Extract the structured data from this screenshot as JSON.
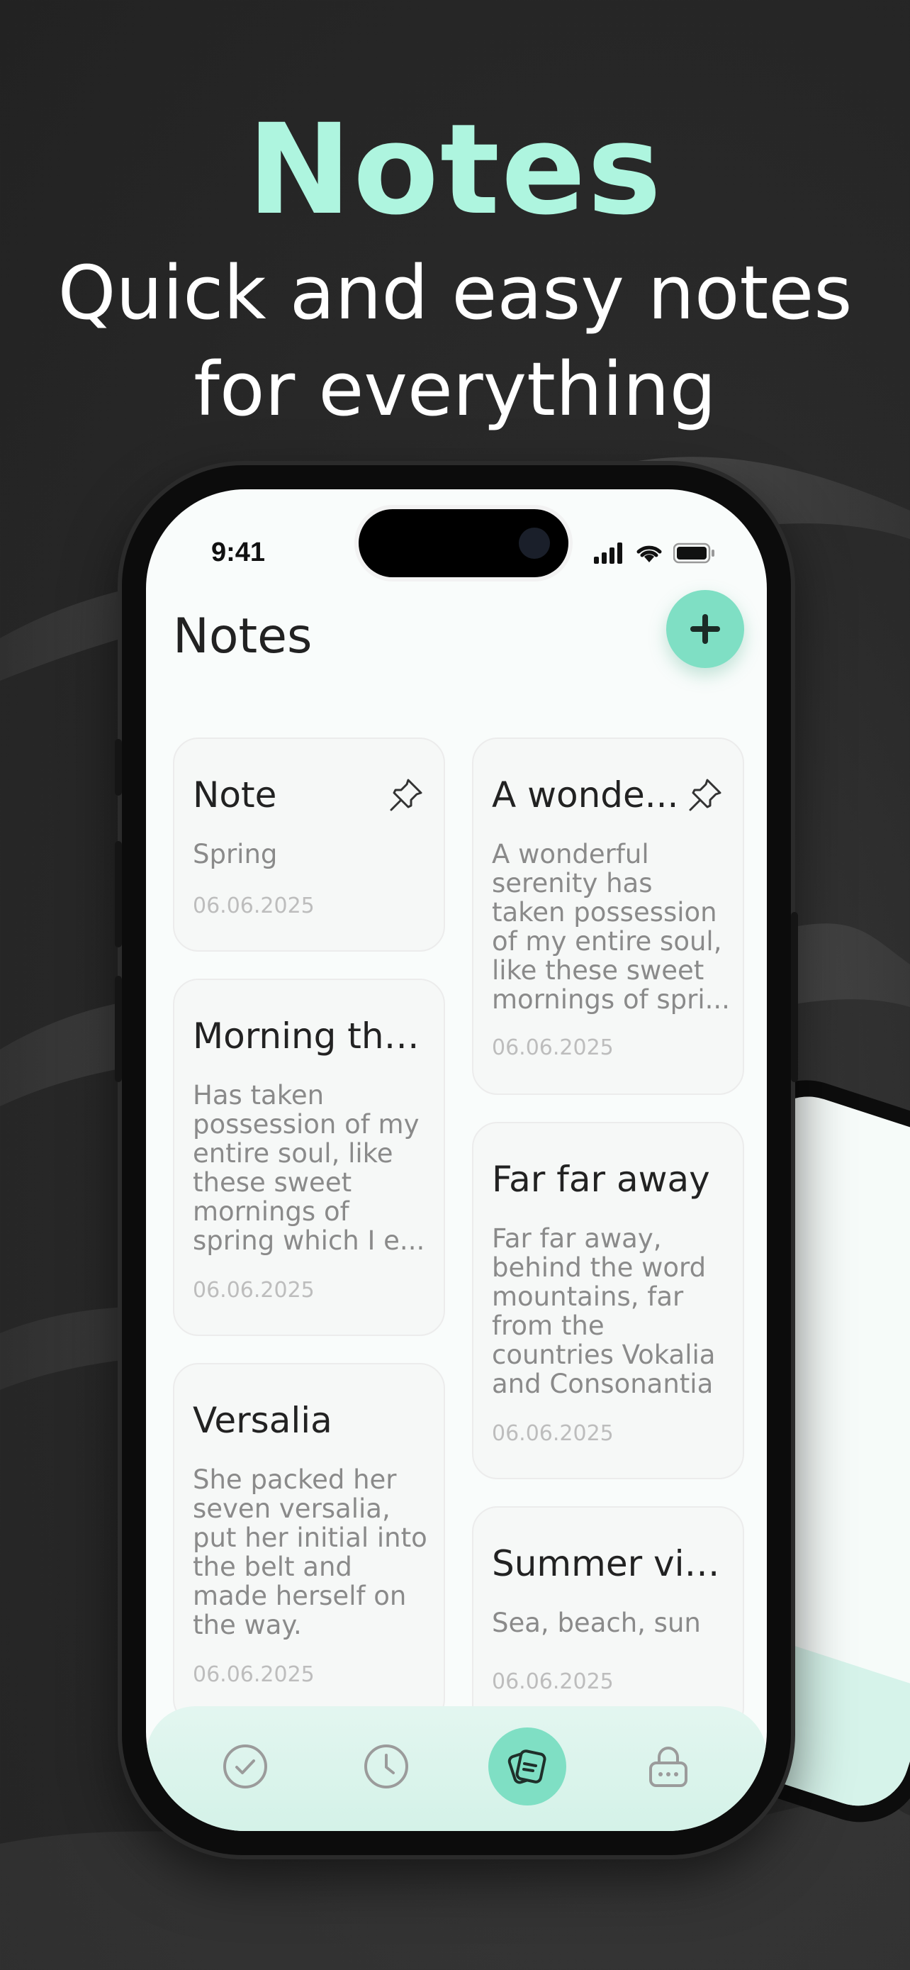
{
  "hero": {
    "title": "Notes",
    "subtitle_line1": "Quick and easy notes",
    "subtitle_line2": "for everything"
  },
  "status_bar": {
    "time": "9:41"
  },
  "header": {
    "title": "Notes",
    "add_icon": "plus-icon"
  },
  "notes_left": [
    {
      "title": "Note",
      "body": "Spring",
      "date": "06.06.2025",
      "pinned": true
    },
    {
      "title": "Morning tho...",
      "body": "Has taken possession of my entire soul, like these sweet mornings of spring which I e...",
      "date": "06.06.2025",
      "pinned": false
    },
    {
      "title": "Versalia",
      "body": "She packed her seven versalia, put her initial into the belt and made herself on the way.",
      "date": "06.06.2025",
      "pinned": false
    }
  ],
  "notes_right": [
    {
      "title": "A wonde...",
      "body": "A wonderful serenity has taken possession of my entire soul, like these sweet mornings of spri...",
      "date": "06.06.2025",
      "pinned": true
    },
    {
      "title": "Far far away",
      "body": "Far far away, behind the word mountains, far from the countries Vokalia and Consonantia",
      "date": "06.06.2025",
      "pinned": false
    },
    {
      "title": "Summer vib...",
      "body": "Sea, beach, sun",
      "date": "06.06.2025",
      "pinned": false
    }
  ],
  "bottom_nav": [
    {
      "icon": "check-circle-icon",
      "active": false
    },
    {
      "icon": "clock-icon",
      "active": false
    },
    {
      "icon": "notes-icon",
      "active": true
    },
    {
      "icon": "lock-icon",
      "active": false
    }
  ],
  "colors": {
    "accent": "#7fdfc4",
    "hero_title": "#aef5df",
    "background": "#2a2a2a"
  }
}
